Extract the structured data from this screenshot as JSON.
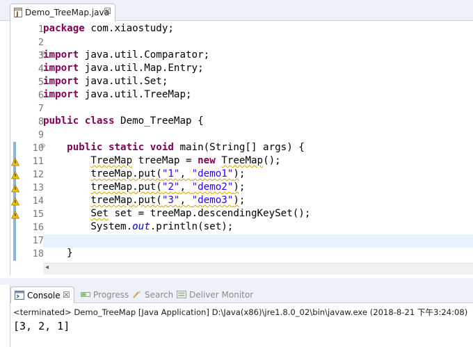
{
  "editor": {
    "tab_title": "Demo_TreeMap.java",
    "tab_close": "☒",
    "lines": [
      {
        "num": "1",
        "tokens": [
          {
            "t": "package",
            "c": "kw"
          },
          {
            "t": " com.xiaostudy;",
            "c": ""
          }
        ]
      },
      {
        "num": "2",
        "tokens": []
      },
      {
        "num": "3",
        "fold": "⊖",
        "tokens": [
          {
            "t": "import",
            "c": "kw"
          },
          {
            "t": " java.util.Comparator;",
            "c": ""
          }
        ]
      },
      {
        "num": "4",
        "tokens": [
          {
            "t": "import",
            "c": "kw"
          },
          {
            "t": " java.util.Map.Entry;",
            "c": ""
          }
        ]
      },
      {
        "num": "5",
        "tokens": [
          {
            "t": "import",
            "c": "kw"
          },
          {
            "t": " java.util.Set;",
            "c": ""
          }
        ]
      },
      {
        "num": "6",
        "tokens": [
          {
            "t": "import",
            "c": "kw"
          },
          {
            "t": " java.util.TreeMap;",
            "c": ""
          }
        ]
      },
      {
        "num": "7",
        "tokens": []
      },
      {
        "num": "8",
        "tokens": [
          {
            "t": "public",
            "c": "kw"
          },
          {
            "t": " ",
            "c": ""
          },
          {
            "t": "class",
            "c": "kw"
          },
          {
            "t": " Demo_TreeMap {",
            "c": ""
          }
        ]
      },
      {
        "num": "9",
        "tokens": []
      },
      {
        "num": "10",
        "fold": "⊖",
        "tokens": [
          {
            "t": "    ",
            "c": ""
          },
          {
            "t": "public",
            "c": "kw"
          },
          {
            "t": " ",
            "c": ""
          },
          {
            "t": "static",
            "c": "kw"
          },
          {
            "t": " ",
            "c": ""
          },
          {
            "t": "void",
            "c": "kw"
          },
          {
            "t": " main(String[] args) {",
            "c": ""
          }
        ]
      },
      {
        "num": "11",
        "warn": true,
        "tokens": [
          {
            "t": "        ",
            "c": ""
          },
          {
            "t": "TreeMap",
            "c": "warn-ul"
          },
          {
            "t": " treeMap = ",
            "c": ""
          },
          {
            "t": "new",
            "c": "kw"
          },
          {
            "t": " ",
            "c": ""
          },
          {
            "t": "TreeMap",
            "c": "warn-ul"
          },
          {
            "t": "();",
            "c": ""
          }
        ]
      },
      {
        "num": "12",
        "warn": true,
        "tokens": [
          {
            "t": "        ",
            "c": ""
          },
          {
            "t": "treeMap.put(",
            "c": "warn-ul"
          },
          {
            "t": "\"1\"",
            "c": "str warn-ul"
          },
          {
            "t": ", ",
            "c": "warn-ul"
          },
          {
            "t": "\"demo1\"",
            "c": "str warn-ul"
          },
          {
            "t": ")",
            "c": "warn-ul"
          },
          {
            "t": ";",
            "c": ""
          }
        ]
      },
      {
        "num": "13",
        "warn": true,
        "tokens": [
          {
            "t": "        ",
            "c": ""
          },
          {
            "t": "treeMap.put(",
            "c": "warn-ul"
          },
          {
            "t": "\"2\"",
            "c": "str warn-ul"
          },
          {
            "t": ", ",
            "c": "warn-ul"
          },
          {
            "t": "\"demo2\"",
            "c": "str warn-ul"
          },
          {
            "t": ")",
            "c": "warn-ul"
          },
          {
            "t": ";",
            "c": ""
          }
        ]
      },
      {
        "num": "14",
        "warn": true,
        "tokens": [
          {
            "t": "        ",
            "c": ""
          },
          {
            "t": "treeMap.put(",
            "c": "warn-ul"
          },
          {
            "t": "\"3\"",
            "c": "str warn-ul"
          },
          {
            "t": ", ",
            "c": "warn-ul"
          },
          {
            "t": "\"demo3\"",
            "c": "str warn-ul"
          },
          {
            "t": ")",
            "c": "warn-ul"
          },
          {
            "t": ";",
            "c": ""
          }
        ]
      },
      {
        "num": "15",
        "warn": true,
        "tokens": [
          {
            "t": "        ",
            "c": ""
          },
          {
            "t": "Set",
            "c": "warn-ul"
          },
          {
            "t": " set = treeMap.descendingKeySet();",
            "c": ""
          }
        ]
      },
      {
        "num": "16",
        "tokens": [
          {
            "t": "        System.",
            "c": ""
          },
          {
            "t": "out",
            "c": "static-ital"
          },
          {
            "t": ".println(set);",
            "c": ""
          }
        ]
      },
      {
        "num": "17",
        "current": true,
        "tokens": []
      },
      {
        "num": "18",
        "tokens": [
          {
            "t": "    }",
            "c": ""
          }
        ]
      }
    ],
    "scroll_left_arrow": "◂"
  },
  "console": {
    "tabs": [
      {
        "label": "Console",
        "icon": "console-icon",
        "active": true,
        "close": "☒"
      },
      {
        "label": "Progress",
        "icon": "progress-icon",
        "active": false
      },
      {
        "label": "Search",
        "icon": "search-icon",
        "active": false
      },
      {
        "label": "Deliver Monitor",
        "icon": "deliver-monitor-icon",
        "active": false
      }
    ],
    "terminated_text": "<terminated> Demo_TreeMap [Java Application] D:\\Java(x86)\\jre1.8.0_02\\bin\\javaw.exe (2018-8-21 下午3:24:08)",
    "output": "[3, 2, 1]"
  },
  "colors": {
    "keyword": "#7f0055",
    "string": "#2a00ff",
    "static_field": "#0000c0",
    "warning_underline": "#d9a200",
    "current_line": "#e8f2fe",
    "chrome": "#eef2f8"
  }
}
